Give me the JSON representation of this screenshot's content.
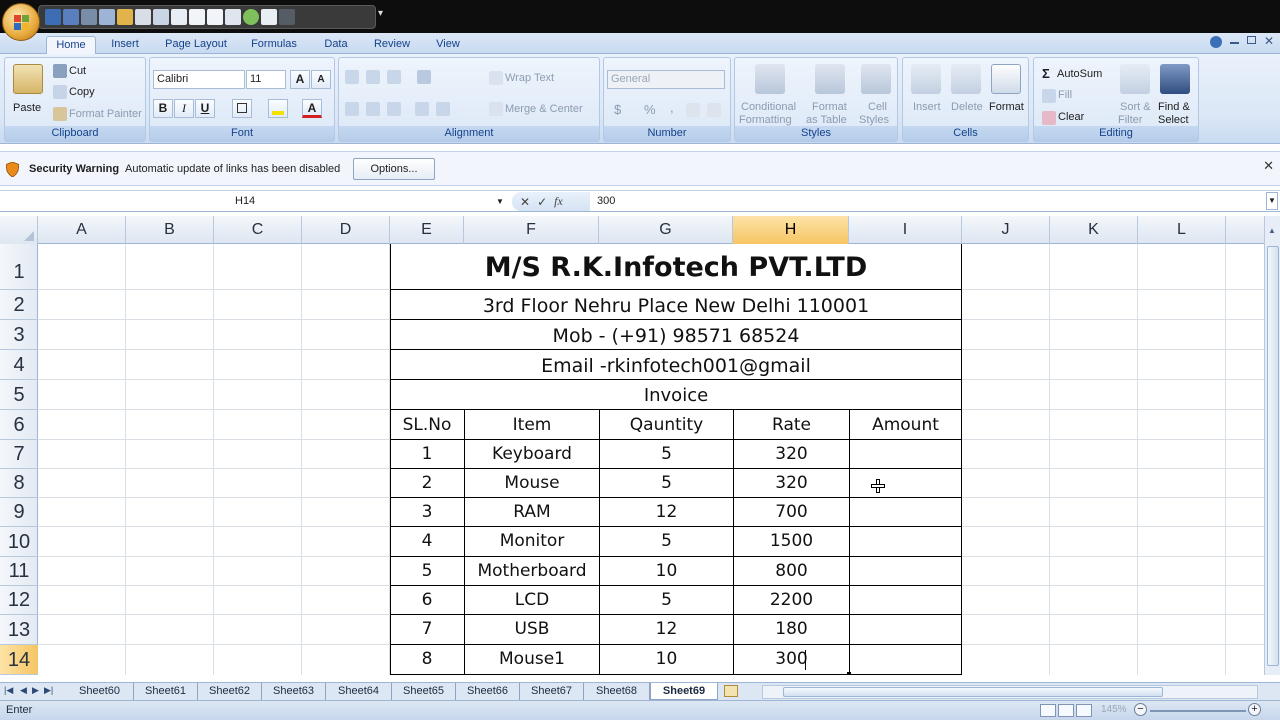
{
  "qat": {
    "more": "▾"
  },
  "tabs": [
    "Home",
    "Insert",
    "Page Layout",
    "Formulas",
    "Data",
    "Review",
    "View"
  ],
  "ribbon": {
    "clipboard": {
      "paste": "Paste",
      "cut": "Cut",
      "copy": "Copy",
      "format_painter": "Format Painter",
      "label": "Clipboard"
    },
    "font": {
      "name": "Calibri",
      "size": "11",
      "label": "Font",
      "grow": "A",
      "shrink": "A",
      "bold": "B",
      "italic": "I",
      "underline": "U",
      "font_color": "A"
    },
    "alignment": {
      "wrap_text": "Wrap Text",
      "merge_center": "Merge & Center",
      "label": "Alignment"
    },
    "number": {
      "format": "General",
      "currency": "$",
      "percent": "%",
      "comma": ",",
      "label": "Number"
    },
    "styles": {
      "conditional_1": "Conditional",
      "conditional_2": "Formatting",
      "format_table_1": "Format",
      "format_table_2": "as Table",
      "cell_styles_1": "Cell",
      "cell_styles_2": "Styles",
      "label": "Styles"
    },
    "cells": {
      "insert": "Insert",
      "delete": "Delete",
      "format": "Format",
      "label": "Cells"
    },
    "editing": {
      "autosum": "AutoSum",
      "fill": "Fill",
      "clear": "Clear",
      "sort_1": "Sort &",
      "sort_2": "Filter",
      "find_1": "Find &",
      "find_2": "Select",
      "label": "Editing"
    }
  },
  "security": {
    "title": "Security Warning",
    "message": "Automatic update of links has been disabled",
    "options": "Options..."
  },
  "formula_bar": {
    "name_box": "H14",
    "value": "300"
  },
  "columns": [
    "A",
    "B",
    "C",
    "D",
    "E",
    "F",
    "G",
    "H",
    "I",
    "J",
    "K",
    "L"
  ],
  "selected_column": "H",
  "rows": [
    "1",
    "2",
    "3",
    "4",
    "5",
    "6",
    "7",
    "8",
    "9",
    "10",
    "11",
    "12",
    "13",
    "14"
  ],
  "selected_row": "14",
  "invoice": {
    "company": "M/S R.K.Infotech PVT.LTD",
    "address": "3rd Floor Nehru Place New Delhi 110001",
    "mobile": "Mob - (+91) 98571 68524",
    "email": "Email -rkinfotech001@gmail",
    "title": "Invoice",
    "headers": [
      "SL.No",
      "Item",
      "Qauntity",
      "Rate",
      "Amount"
    ],
    "items": [
      {
        "sl": "1",
        "item": "Keyboard",
        "qty": "5",
        "rate": "320",
        "amount": ""
      },
      {
        "sl": "2",
        "item": "Mouse",
        "qty": "5",
        "rate": "320",
        "amount": ""
      },
      {
        "sl": "3",
        "item": "RAM",
        "qty": "12",
        "rate": "700",
        "amount": ""
      },
      {
        "sl": "4",
        "item": "Monitor",
        "qty": "5",
        "rate": "1500",
        "amount": ""
      },
      {
        "sl": "5",
        "item": "Motherboard",
        "qty": "10",
        "rate": "800",
        "amount": ""
      },
      {
        "sl": "6",
        "item": "LCD",
        "qty": "5",
        "rate": "2200",
        "amount": ""
      },
      {
        "sl": "7",
        "item": "USB",
        "qty": "12",
        "rate": "180",
        "amount": ""
      },
      {
        "sl": "8",
        "item": "Mouse1",
        "qty": "10",
        "rate": "300",
        "amount": ""
      }
    ]
  },
  "sheets": [
    "Sheet60",
    "Sheet61",
    "Sheet62",
    "Sheet63",
    "Sheet64",
    "Sheet65",
    "Sheet66",
    "Sheet67",
    "Sheet68",
    "Sheet69"
  ],
  "active_sheet": "Sheet69",
  "status": {
    "mode": "Enter",
    "zoom": "145%"
  },
  "colors": {
    "selection": "#f6c563",
    "ribbon": "#dbe7f6",
    "border": "#9eb6d6"
  }
}
